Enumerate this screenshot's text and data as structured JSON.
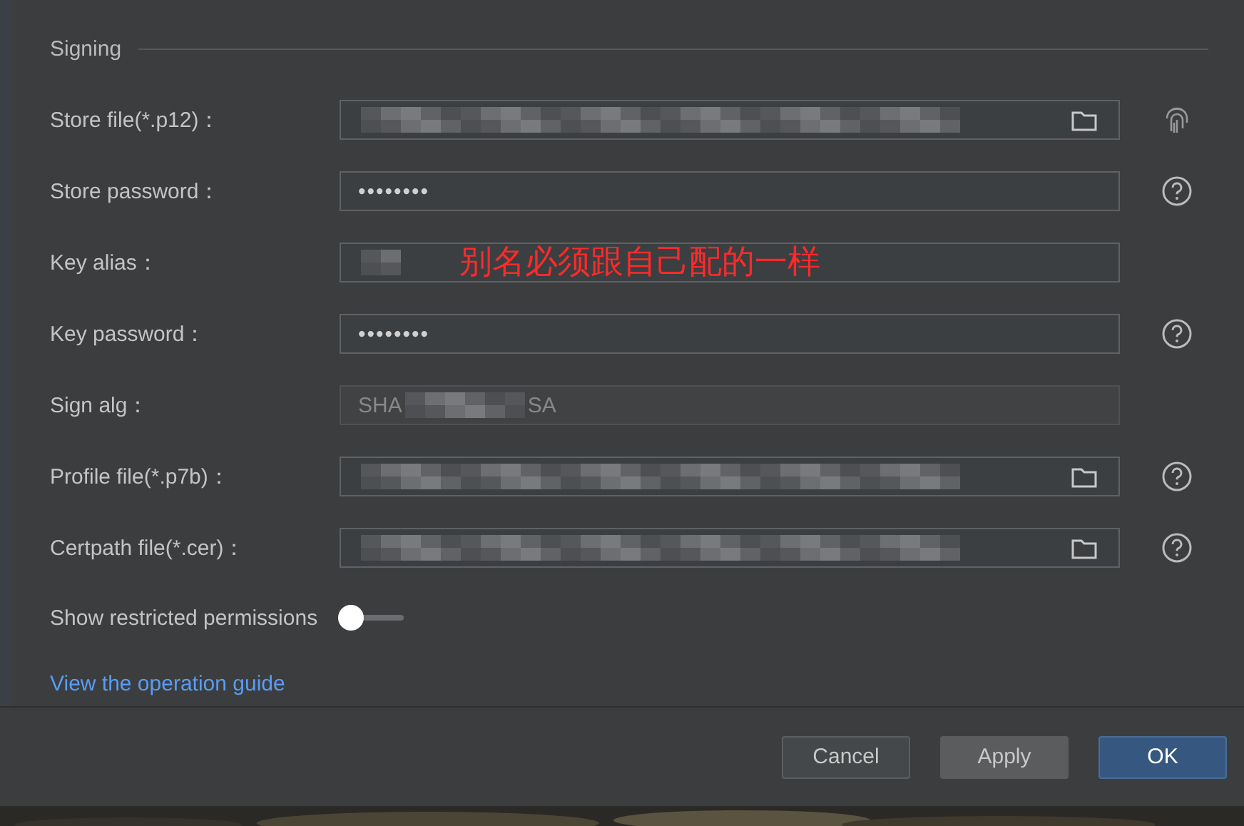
{
  "section": {
    "title": "Signing"
  },
  "fields": [
    {
      "label": "Store file(*.p12)：",
      "kind": "file",
      "redacted": true,
      "action": {
        "kind": "fingerprint"
      }
    },
    {
      "label": "Store password：",
      "kind": "password",
      "value": "••••••••",
      "action": {
        "kind": "help"
      }
    },
    {
      "label": "Key alias：",
      "kind": "text",
      "redacted": true,
      "annotation": "别名必须跟自己配的一样"
    },
    {
      "label": "Key password：",
      "kind": "password",
      "value": "••••••••",
      "action": {
        "kind": "help"
      }
    },
    {
      "label": "Sign alg：",
      "kind": "readonly",
      "value": "SHA",
      "value_end": "SA",
      "redacted": true
    },
    {
      "label": "Profile file(*.p7b)：",
      "kind": "file",
      "redacted": true,
      "action": {
        "kind": "help"
      }
    },
    {
      "label": "Certpath file(*.cer)：",
      "kind": "file",
      "redacted": true,
      "action": {
        "kind": "help"
      }
    }
  ],
  "toggle": {
    "label": "Show restricted permissions",
    "on": false
  },
  "link": "View the operation guide",
  "buttons": [
    {
      "label": "Cancel",
      "kind": "secondary"
    },
    {
      "label": "Apply",
      "kind": "muted"
    },
    {
      "label": "OK",
      "kind": "primary"
    }
  ]
}
